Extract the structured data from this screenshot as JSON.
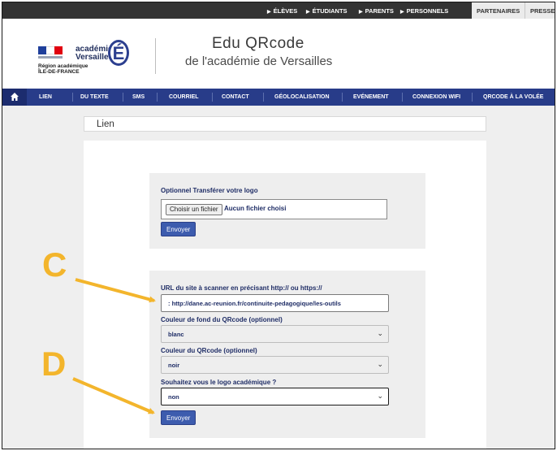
{
  "topbar": {
    "audiences": [
      "ÉLÈVES",
      "ÉTUDIANTS",
      "PARENTS",
      "PERSONNELS"
    ],
    "partners": "PARTENAIRES",
    "press": "PRESSE"
  },
  "header": {
    "logo_line1": "académie",
    "logo_line2": "Versailles",
    "logo_letter": "É",
    "region_line1": "Région académique",
    "region_line2": "ÎLE-DE-FRANCE",
    "title": "Edu QRcode",
    "subtitle": "de l'académie de Versailles"
  },
  "nav": {
    "items": [
      "LIEN",
      "DU TEXTE",
      "SMS",
      "COURRIEL",
      "CONTACT",
      "GÉOLOCALISATION",
      "EVÉNEMENT",
      "CONNEXION WIFI",
      "QRCODE À LA VOLÉE"
    ]
  },
  "page": {
    "title": "Lien"
  },
  "logo_upload": {
    "label": "Optionnel Transférer votre logo",
    "choose_button": "Choisir un fichier",
    "no_file": "Aucun fichier choisi",
    "send_button": "Envoyer"
  },
  "form": {
    "url_label": "URL du site à scanner en précisant http:// ou https://",
    "url_value": ": http://dane.ac-reunion.fr/continuite-pedagogique/les-outils",
    "bg_color_label": "Couleur de fond du QRcode (optionnel)",
    "bg_color_value": "blanc",
    "fg_color_label": "Couleur du QRcode (optionnel)",
    "fg_color_value": "noir",
    "logo_question": "Souhaitez vous le logo académique ?",
    "logo_answer": "non",
    "submit_button": "Envoyer"
  },
  "annotations": {
    "c": "C",
    "d": "D"
  },
  "colors": {
    "nav": "#283c89",
    "button": "#3d5cae",
    "label": "#1f2d66",
    "callout": "#f3b52c"
  }
}
